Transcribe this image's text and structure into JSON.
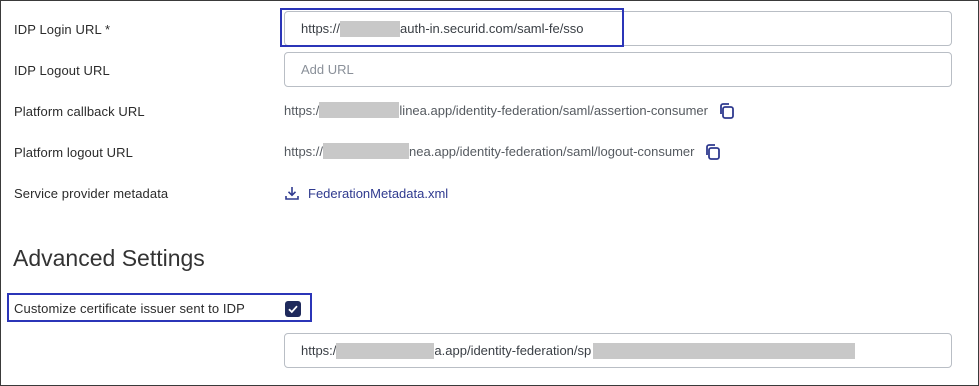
{
  "fields": {
    "idp_login": {
      "label": "IDP Login URL",
      "required_mark": "*",
      "value_prefix": "https://",
      "value_suffix": "auth-in.securid.com/saml-fe/sso"
    },
    "idp_logout": {
      "label": "IDP Logout URL",
      "placeholder": "Add URL"
    },
    "platform_callback": {
      "label": "Platform callback URL",
      "value_prefix": "https:/",
      "value_suffix": "linea.app/identity-federation/saml/assertion-consumer",
      "copy_icon": "copy-icon"
    },
    "platform_logout": {
      "label": "Platform logout URL",
      "value_prefix": "https://",
      "value_suffix": "nea.app/identity-federation/saml/logout-consumer",
      "copy_icon": "copy-icon"
    },
    "sp_metadata": {
      "label": "Service provider metadata",
      "link_text": "FederationMetadata.xml",
      "icon": "download-icon"
    }
  },
  "advanced": {
    "title": "Advanced Settings",
    "customize_issuer": {
      "label": "Customize certificate issuer sent to IDP",
      "checked": true
    },
    "issuer_field": {
      "value_prefix": "https:/",
      "value_middle": "a.app/identity-federation/sp"
    }
  },
  "colors": {
    "highlight": "#2b35b8",
    "link": "#2f3a8f",
    "checkbox": "#1f2a5c"
  }
}
